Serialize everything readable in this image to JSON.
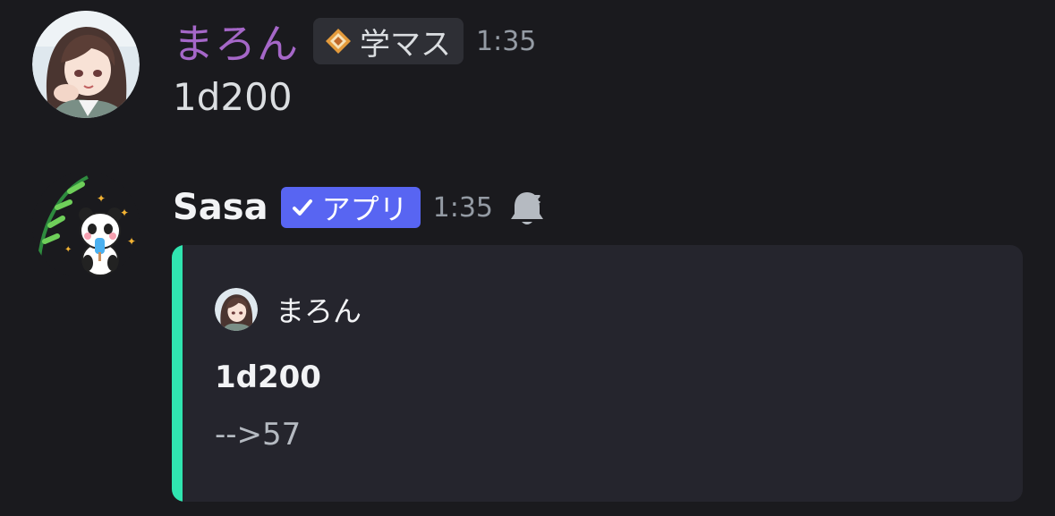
{
  "messages": [
    {
      "author": "まろん",
      "tag": "学マス",
      "timestamp": "1:35",
      "content": "1d200",
      "avatar_icon": "anime-girl-avatar",
      "name_color": "#a567c8"
    },
    {
      "author": "Sasa",
      "badge": "アプリ",
      "timestamp": "1:35",
      "avatar_icon": "panda-bamboo-avatar",
      "status_icon": "bell-snooze-icon",
      "embed": {
        "author": "まろん",
        "title": "1d200",
        "description": "-->57",
        "accent_color": "#30e5b0"
      }
    }
  ],
  "colors": {
    "background": "#1a1a1e",
    "app_badge": "#5865f2",
    "embed_background": "#25252d"
  }
}
